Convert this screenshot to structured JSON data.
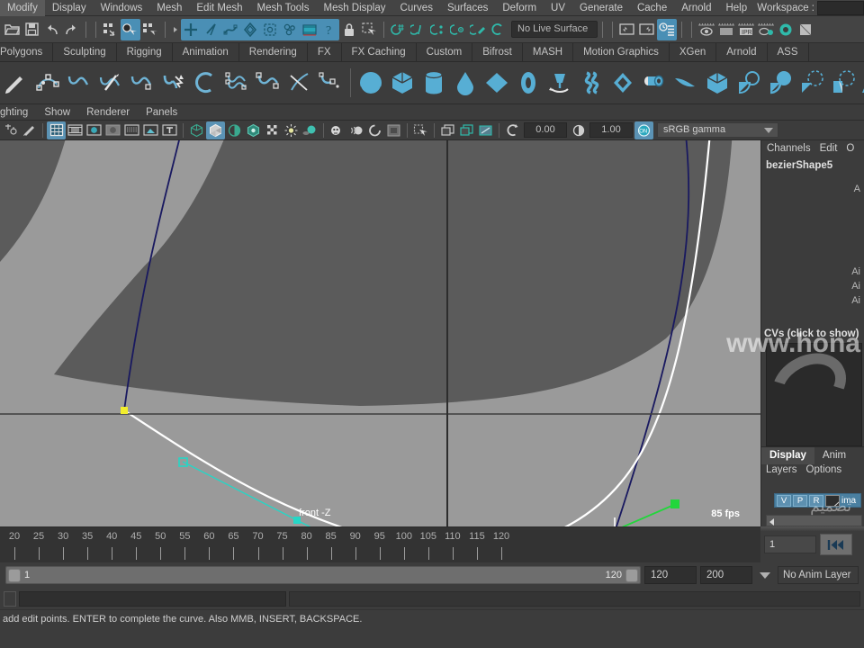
{
  "app": {
    "menubar": [
      {
        "label": "Modify"
      },
      {
        "label": "Display"
      },
      {
        "label": "Windows"
      },
      {
        "label": "Mesh"
      },
      {
        "label": "Edit Mesh"
      },
      {
        "label": "Mesh Tools"
      },
      {
        "label": "Mesh Display"
      },
      {
        "label": "Curves"
      },
      {
        "label": "Surfaces"
      },
      {
        "label": "Deform"
      },
      {
        "label": "UV"
      },
      {
        "label": "Generate"
      },
      {
        "label": "Cache"
      },
      {
        "label": "Arnold"
      },
      {
        "label": "Help"
      }
    ],
    "workspace_label": "Workspace :"
  },
  "statusline": {
    "live_surface": "No Live Surface",
    "icons": [
      "open-scene-icon",
      "save-scene-icon",
      "undo-icon",
      "redo-icon",
      "select-hierarchy-icon",
      "select-object-icon",
      "select-component-icon",
      "snap-grid-icon",
      "snap-curve-icon",
      "snap-point-icon",
      "snap-view-plane-icon",
      "snap-projected-center-icon",
      "make-live-icon",
      "render-current-frame-icon",
      "ipr-render-icon",
      "render-settings-icon",
      "hypershade-icon",
      "render-view-icon"
    ]
  },
  "shelf": {
    "tabs": [
      {
        "label": "Polygons",
        "active": false
      },
      {
        "label": "Sculpting",
        "active": false
      },
      {
        "label": "Rigging",
        "active": false
      },
      {
        "label": "Animation",
        "active": false
      },
      {
        "label": "Rendering",
        "active": false
      },
      {
        "label": "FX",
        "active": false
      },
      {
        "label": "FX Caching",
        "active": false
      },
      {
        "label": "Custom",
        "active": false
      },
      {
        "label": "Bifrost",
        "active": false
      },
      {
        "label": "MASH",
        "active": false
      },
      {
        "label": "Motion Graphics",
        "active": false
      },
      {
        "label": "XGen",
        "active": false
      },
      {
        "label": "Arnold",
        "active": false
      },
      {
        "label": "ASS",
        "active": false
      }
    ],
    "icon_names": [
      "pencil-curve-icon",
      "ep-curve-icon",
      "bezier-curve-icon",
      "cut-curve-icon",
      "arc-curve-icon",
      "curve-direction-icon",
      "arc-tool-icon",
      "offset-curve-icon",
      "attach-curve-icon",
      "cv-curve-icon",
      "curve-fillet-icon"
    ],
    "prim_icon_names": [
      "sphere-icon",
      "cube-icon",
      "cylinder-icon",
      "cone-icon",
      "plane-icon",
      "torus-icon",
      "pyramid-icon",
      "helix-icon",
      "soft-body-icon",
      "pipe-icon",
      "bend-icon",
      "boolean-cube-icon",
      "circular-fillet-icon",
      "revolve-icon",
      "loft-icon",
      "planar-icon",
      "extrude-icon"
    ]
  },
  "panelmenu": {
    "items": [
      {
        "label": "ghting"
      },
      {
        "label": "Show"
      },
      {
        "label": "Renderer"
      },
      {
        "label": "Panels"
      }
    ]
  },
  "vptoolbar": {
    "exposure": "0.00",
    "gamma": "1.00",
    "color_management": "sRGB gamma",
    "toggle_on_label": "ON",
    "icon_names": [
      "select-tool-icon",
      "paint-tool-icon",
      "grid-toggle-icon",
      "film-gate-icon",
      "resolution-gate-icon",
      "gate-mask-icon",
      "film-origin-icon",
      "xray-icon",
      "text-icon",
      "wireframe-icon",
      "smooth-shade-icon",
      "shade-wireframe-icon",
      "textured-icon",
      "checker-icon",
      "use-all-lights-icon",
      "shadows-icon",
      "screen-space-ao-icon",
      "motion-blur-icon",
      "multisample-icon",
      "depth-of-field-icon",
      "isolate-select-icon",
      "xray-joints-icon",
      "two-d-pan-zoom-icon",
      "grease-pencil-icon",
      "exposure-icon",
      "contrast-icon",
      "color-management-toggle-icon"
    ]
  },
  "viewport": {
    "front_label": "front -Z",
    "fps_label": "85 fps",
    "colors": {
      "background": "#9a9a9a",
      "shaded_surface": "#5b5b5b",
      "curve_blue": "#1a1a5e",
      "curve_white": "#ffffff",
      "tangent_cyan": "#22d3c6",
      "tangent_green": "#1fd83a",
      "cv_yellow": "#f0ec2a"
    }
  },
  "channelbox": {
    "tabs": [
      "Channels",
      "Edit",
      "O"
    ],
    "shape_name": "bezierShape5",
    "rows": [
      "A",
      "Ai",
      "Ai",
      "Ai"
    ],
    "cvs_label": "CVs (click to show)"
  },
  "layereditor": {
    "tabs": [
      {
        "label": "Display",
        "active": true
      },
      {
        "label": "Anim",
        "active": false
      }
    ],
    "menus": [
      "Layers",
      "Options"
    ],
    "layer": {
      "visibility": "V",
      "playback": "P",
      "reference": "R",
      "name": "ima"
    }
  },
  "timeline": {
    "ticks": [
      20,
      25,
      30,
      35,
      40,
      45,
      50,
      55,
      60,
      65,
      70,
      75,
      80,
      85,
      90,
      95,
      100,
      105,
      110,
      115,
      120
    ],
    "current_frame": "1"
  },
  "rangeslider": {
    "range_start": "1",
    "range_end": "120",
    "playback_end": "120",
    "anim_end": "200",
    "anim_layer": "No Anim Layer"
  },
  "helpline": {
    "message": "add edit points. ENTER to complete the curve. Also MMB, INSERT, BACKSPACE."
  },
  "watermark": {
    "text": "www.hona",
    "arabic": "تصميم"
  }
}
